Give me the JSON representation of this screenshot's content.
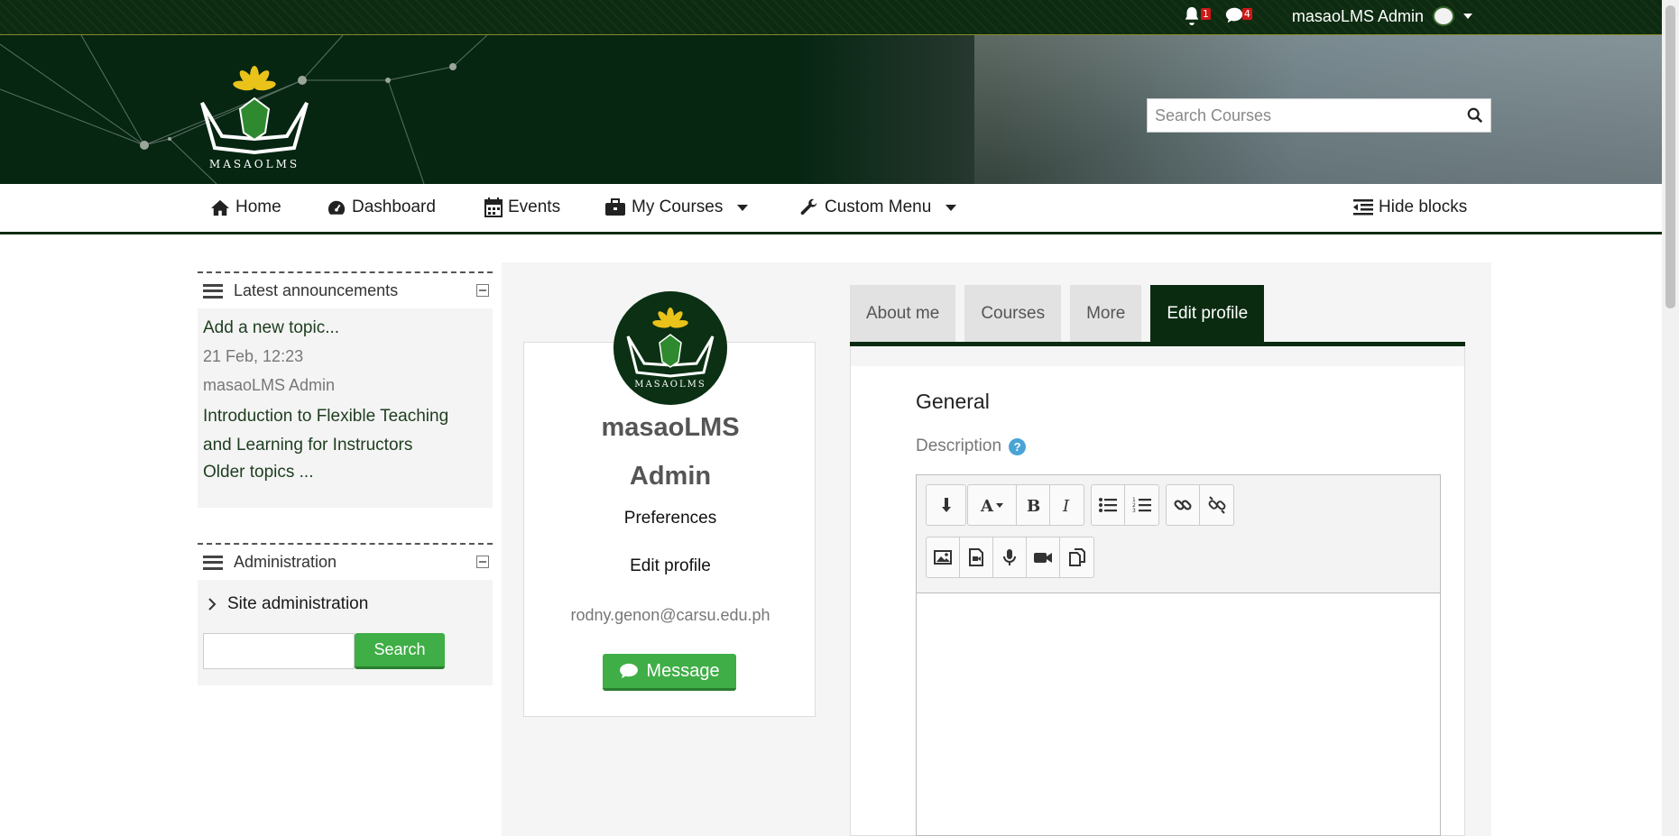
{
  "topbar": {
    "notifications_count": "1",
    "messages_count": "4",
    "user_name": "masaoLMS Admin"
  },
  "search": {
    "placeholder": "Search Courses"
  },
  "nav": {
    "home": "Home",
    "dashboard": "Dashboard",
    "events": "Events",
    "my_courses": "My Courses",
    "custom_menu": "Custom Menu",
    "hide_blocks": "Hide blocks"
  },
  "latest_announcements": {
    "title": "Latest announcements",
    "add_topic": "Add a new topic...",
    "post_date": "21 Feb, 12:23",
    "post_author": "masaoLMS Admin",
    "post_title_line1": "Introduction to Flexible Teaching",
    "post_title_line2": "and Learning for Instructors",
    "older": "Older topics ..."
  },
  "administration": {
    "title": "Administration",
    "site_admin": "Site administration",
    "search_button": "Search"
  },
  "profile": {
    "name_line1": "masaoLMS",
    "name_line2": "Admin",
    "preferences": "Preferences",
    "edit_profile": "Edit profile",
    "email": "rodny.genon@carsu.edu.ph",
    "message_button": "Message"
  },
  "tabs": [
    "About me",
    "Courses",
    "More",
    "Edit profile"
  ],
  "form": {
    "section": "General",
    "description_label": "Description"
  },
  "logo_text": "MASAOLMS",
  "colors": {
    "brand_green": "#0b2b11",
    "button_green": "#3fae46",
    "help_blue": "#4aa4d6",
    "badge_red": "#d01818"
  }
}
